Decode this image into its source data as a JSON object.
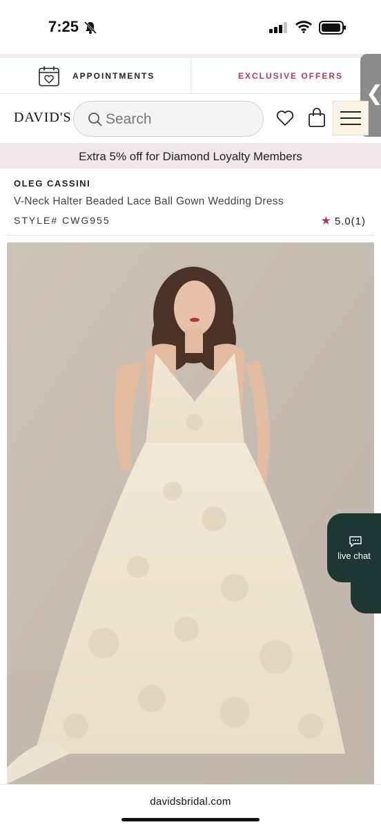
{
  "status_bar": {
    "time": "7:25",
    "icons": [
      "bell-slash-icon",
      "signal-icon",
      "wifi-icon",
      "battery-icon"
    ]
  },
  "top_links": {
    "appointments_label": "APPOINTMENTS",
    "appointments_icon": "calendar-heart-icon",
    "offers_label": "EXCLUSIVE OFFERS"
  },
  "side_tab": {
    "glyph": "❮"
  },
  "header": {
    "logo": "DAVID'S",
    "search_placeholder": "Search",
    "icons": [
      "heart-icon",
      "shopping-bag-icon",
      "menu-icon"
    ]
  },
  "promo": {
    "text": "Extra 5% off for Diamond Loyalty Members"
  },
  "product": {
    "designer": "OLEG CASSINI",
    "name": "V-Neck Halter Beaded Lace Ball Gown Wedding Dress",
    "style": "STYLE# CWG955",
    "rating": "5.0(1)",
    "rating_stars": 5.0
  },
  "live_chat": {
    "label": "live chat"
  },
  "url_bar": {
    "url": "davidsbridal.com"
  },
  "colors": {
    "accent": "#b03a5c",
    "promo_bg": "#f3e6ea",
    "chat_bg": "#1e3732",
    "photo_bg": "#c7bdb3"
  }
}
